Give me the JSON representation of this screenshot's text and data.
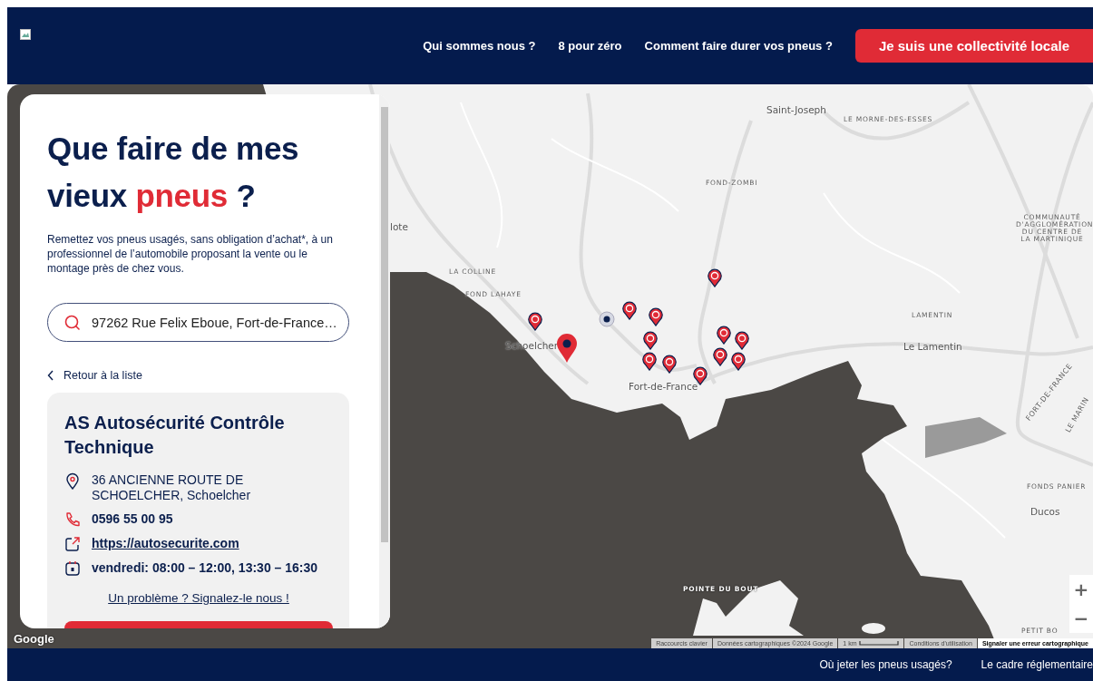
{
  "header": {
    "nav": [
      {
        "label": "Qui sommes nous ?"
      },
      {
        "label": "8 pour zéro"
      },
      {
        "label": "Comment faire durer vos pneus ?"
      }
    ],
    "cta": "Je suis une collectivité locale"
  },
  "panel": {
    "title_parts": [
      {
        "text": "Que faire de mes vieux ",
        "highlight": false
      },
      {
        "text": "pneus",
        "highlight": true
      },
      {
        "text": " ?",
        "highlight": false
      }
    ],
    "intro": "Remettez vos pneus usagés, sans obligation d’achat*, à un professionnel de l’automobile proposant la vente ou le montage près de chez vous.",
    "search": {
      "value": "97262 Rue Felix Eboue, Fort-de-France…"
    },
    "back_link": "Retour à la liste",
    "place": {
      "name": "AS Autosécurité Contrôle Technique",
      "details": [
        {
          "kind": "address",
          "text": "36 ANCIENNE ROUTE DE SCHOELCHER, Schoelcher"
        },
        {
          "kind": "phone",
          "text": "0596 55 00 95"
        },
        {
          "kind": "website",
          "text": "https://autosecurite.com"
        },
        {
          "kind": "hours",
          "text": "vendredi: 08:00 – 12:00, 13:30 – 16:30"
        }
      ],
      "report_link": "Un problème ? Signalez-le nous !"
    }
  },
  "map": {
    "labels": [
      {
        "text": "Saint-Joseph",
        "kind": "town"
      },
      {
        "text": "LE MORNE-DES-ESSES",
        "kind": "area"
      },
      {
        "text": "FOND-ZOMBI",
        "kind": "area"
      },
      {
        "text": "lote",
        "kind": "town"
      },
      {
        "text": "COMMUNAUTÉ D'AGGLOMÉRATION DU CENTRE DE LA MARTINIQUE",
        "kind": "area"
      },
      {
        "text": "LA COLLINE",
        "kind": "area"
      },
      {
        "text": "FOND LAHAYE",
        "kind": "area"
      },
      {
        "text": "Schoelcher",
        "kind": "town"
      },
      {
        "text": "LAMENTIN",
        "kind": "area"
      },
      {
        "text": "Le Lamentin",
        "kind": "town"
      },
      {
        "text": "Fort-de-France",
        "kind": "town"
      },
      {
        "text": "FORT-DE-FRANCE",
        "kind": "road"
      },
      {
        "text": "LE MARIN",
        "kind": "road"
      },
      {
        "text": "FONDS PANIER",
        "kind": "area"
      },
      {
        "text": "Ducos",
        "kind": "town"
      },
      {
        "text": "POINTE DU BOUT",
        "kind": "area"
      },
      {
        "text": "PETIT BO",
        "kind": "area"
      }
    ],
    "logo": "Google",
    "attribution": [
      "Raccourcis clavier",
      "Données cartographiques ©2024 Google",
      "1 km",
      "Conditions d'utilisation",
      "Signaler une erreur cartographique"
    ],
    "zoom_controls": [
      "+",
      "−"
    ]
  },
  "footer": {
    "links": [
      "Où jeter les pneus usagés?",
      "Le cadre réglementaire"
    ]
  }
}
